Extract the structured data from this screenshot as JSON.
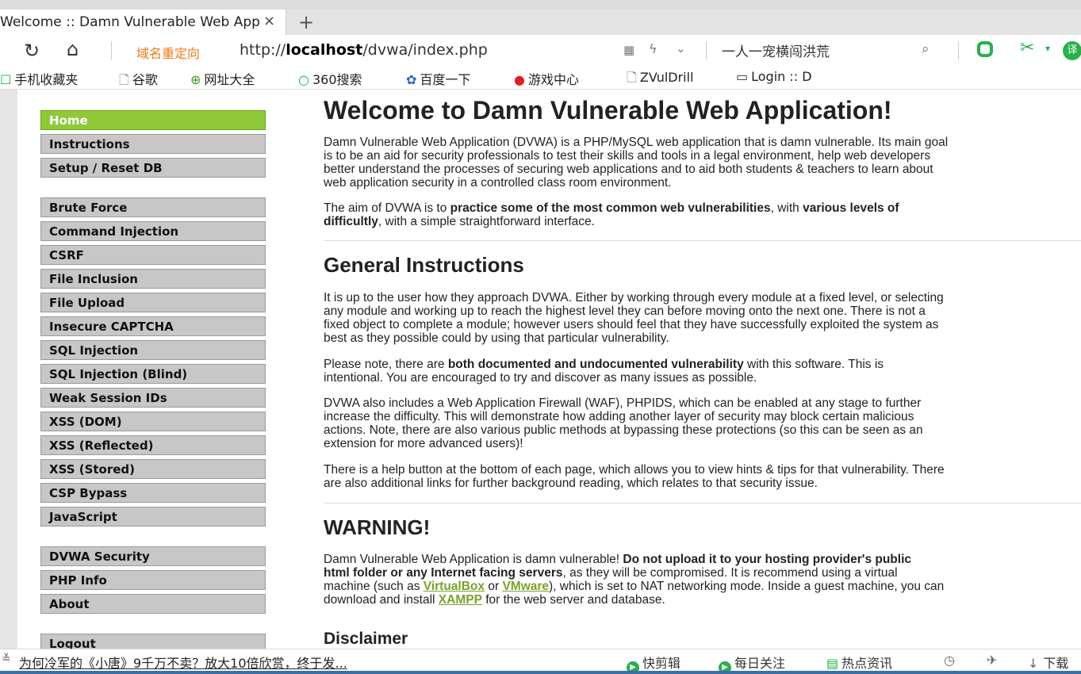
{
  "browser": {
    "tab_title": "Welcome :: Damn Vulnerable Web Application",
    "tab_close": "×",
    "new_tab": "+",
    "redirect_label": "域名重定向",
    "url_prefix": "http://",
    "url_host": "localhost",
    "url_path": "/dvwa/index.php",
    "search_value": "一人一宠横闯洪荒",
    "ext3_label": "译"
  },
  "bookmarks": [
    {
      "icon": "☐",
      "label": "手机收藏夹"
    },
    {
      "icon": "🗋",
      "label": "谷歌"
    },
    {
      "icon": "⊕",
      "label": "网址大全"
    },
    {
      "icon": "○",
      "label": "360搜索"
    },
    {
      "icon": "✿",
      "label": "百度一下"
    },
    {
      "icon": "●",
      "label": "游戏中心"
    },
    {
      "icon": "🗋",
      "label": "ZVulDrill"
    },
    {
      "icon": "▭",
      "label": "Login :: D"
    }
  ],
  "menu": {
    "home": "Home",
    "instructions": "Instructions",
    "setup": "Setup / Reset DB",
    "brute_force": "Brute Force",
    "command_injection": "Command Injection",
    "csrf": "CSRF",
    "file_inclusion": "File Inclusion",
    "file_upload": "File Upload",
    "insecure_captcha": "Insecure CAPTCHA",
    "sql_injection": "SQL Injection",
    "sql_injection_blind": "SQL Injection (Blind)",
    "weak_session_ids": "Weak Session IDs",
    "xss_dom": "XSS (DOM)",
    "xss_reflected": "XSS (Reflected)",
    "xss_stored": "XSS (Stored)",
    "csp_bypass": "CSP Bypass",
    "javascript": "JavaScript",
    "dvwa_security": "DVWA Security",
    "php_info": "PHP Info",
    "about": "About",
    "logout": "Logout"
  },
  "content": {
    "title": "Welcome to Damn Vulnerable Web Application!",
    "intro_l1": "Damn Vulnerable Web Application (DVWA) is a PHP/MySQL web application that is damn vulnerable. Its main goal",
    "intro_l2": "is to be an aid for security professionals to test their skills and tools in a legal environment, help web developers",
    "intro_l3": "better understand the processes of securing web applications and to aid both students & teachers to learn about",
    "intro_l4": "web application security in a controlled class room environment.",
    "aim_a": "The aim of DVWA is to ",
    "aim_b": "practice some of the most common web vulnerabilities",
    "aim_c": ", with ",
    "aim_d": "various levels of",
    "aim_e": "difficultly",
    "aim_f": ", with a simple straightforward interface.",
    "general_heading": "General Instructions",
    "gen_l1": "It is up to the user how they approach DVWA. Either by working through every module at a fixed level, or selecting",
    "gen_l2": "any module and working up to reach the highest level they can before moving onto the next one. There is not a",
    "gen_l3": "fixed object to complete a module; however users should feel that they have successfully exploited the system as",
    "gen_l4": "best as they possible could by using that particular vulnerability.",
    "note_a": "Please note, there are ",
    "note_b": "both documented and undocumented vulnerability",
    "note_c": " with this software. This is",
    "note_l2": "intentional. You are encouraged to try and discover as many issues as possible.",
    "waf_l1": "DVWA also includes a Web Application Firewall (WAF), PHPIDS, which can be enabled at any stage to further",
    "waf_l2": "increase the difficulty. This will demonstrate how adding another layer of security may block certain malicious",
    "waf_l3": "actions. Note, there are also various public methods at bypassing these protections (so this can be seen as an",
    "waf_l4": "extension for more advanced users)!",
    "help_l1": "There is a help button at the bottom of each page, which allows you to view hints & tips for that vulnerability. There",
    "help_l2": "are also additional links for further background reading, which relates to that security issue.",
    "warning_heading": "WARNING!",
    "warn_a": "Damn Vulnerable Web Application is damn vulnerable! ",
    "warn_b": "Do not upload it to your hosting provider's public",
    "warn_c": "html folder or any Internet facing servers",
    "warn_d": ", as they will be compromised. It is recommend using a virtual",
    "warn_e": "machine (such as ",
    "warn_link1": "VirtualBox",
    "warn_f": " or ",
    "warn_link2": "VMware",
    "warn_g": "), which is set to NAT networking mode. Inside a guest machine, you can",
    "warn_h": "download and install ",
    "warn_link3": "XAMPP",
    "warn_i": " for the web server and database.",
    "disclaimer_heading": "Disclaimer"
  },
  "newsbar": {
    "headline": "为何冷军的《小唐》9千万不卖？放大10倍欣赏，终于发...",
    "item1": "快剪辑",
    "item2": "每日关注",
    "item3": "热点资讯",
    "item4": "下载"
  },
  "colors": {
    "menu_active": "#8fc93a",
    "menu_default": "#c7c7c7",
    "link": "#7aa22b",
    "redirect": "#f07a16",
    "ext_green": "#27b14a"
  }
}
